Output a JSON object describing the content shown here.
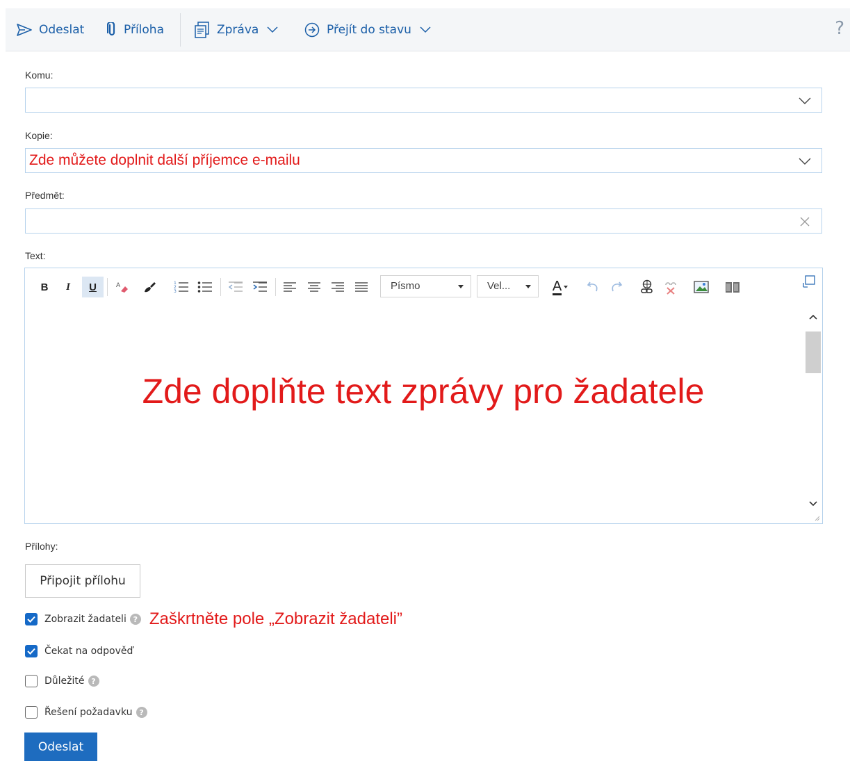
{
  "toolbar": {
    "send_label": "Odeslat",
    "attachment_label": "Příloha",
    "message_label": "Zpráva",
    "goto_state_label": "Přejít do stavu",
    "help_label": "?"
  },
  "form": {
    "to_label": "Komu:",
    "to_value": "",
    "cc_label": "Kopie:",
    "cc_value": "Zde můžete doplnit další příjemce e-mailu",
    "subject_label": "Předmět:",
    "subject_value": "",
    "text_label": "Text:"
  },
  "editor": {
    "bold": "B",
    "italic": "I",
    "underline": "U",
    "font_select": "Písmo",
    "size_select": "Vel...",
    "font_color": "A",
    "content": "Zde doplňte text zprávy pro žadatele"
  },
  "attachments": {
    "label": "Přílohy:",
    "button": "Připojit přílohu"
  },
  "options": {
    "show_to_requester": {
      "label": "Zobrazit žadateli",
      "checked": true,
      "annotation": "Zaškrtněte pole „Zobrazit žadateli”"
    },
    "wait_for_reply": {
      "label": "Čekat na odpověď",
      "checked": true
    },
    "important": {
      "label": "Důležité",
      "checked": false
    },
    "resolution": {
      "label": "Řešení požadavku",
      "checked": false
    }
  },
  "submit_label": "Odeslat",
  "colors": {
    "accent": "#1b5fa8",
    "annotation": "#e21a1a",
    "button": "#1e6cbf",
    "field_border": "#b6d2ec"
  }
}
